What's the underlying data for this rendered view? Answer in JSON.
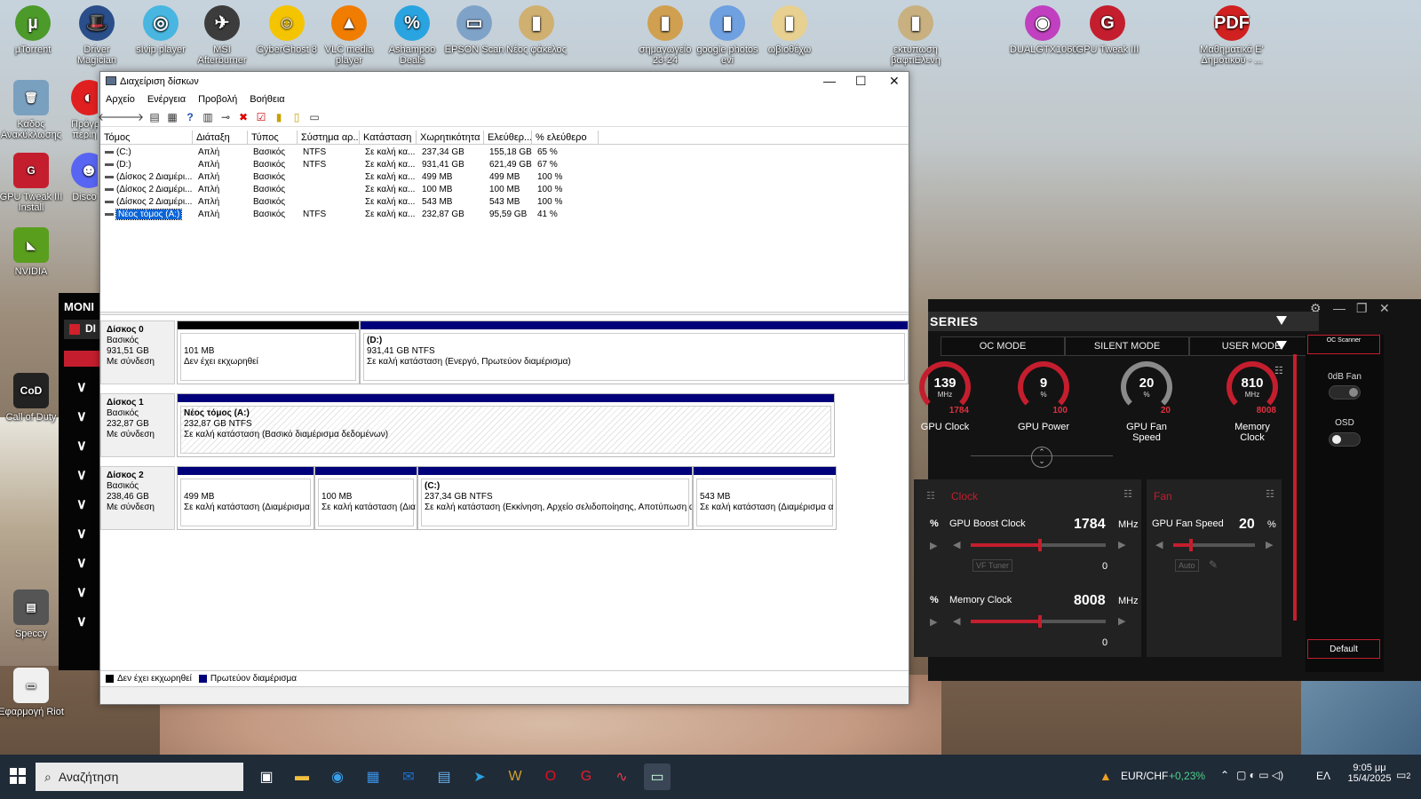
{
  "desktop": {
    "icons_top": [
      {
        "label": "µTorrent",
        "glyph": "µ",
        "color": "#4c9a2a"
      },
      {
        "label": "Driver Magician",
        "glyph": "🎩",
        "color": "#2a4e8a"
      },
      {
        "label": "sIvip player",
        "glyph": "◎",
        "color": "#48b6e0"
      },
      {
        "label": "MSI Afterburner",
        "glyph": "✈",
        "color": "#3c3c3c"
      },
      {
        "label": "CyberGhost 8",
        "glyph": "☺",
        "color": "#f5c400"
      },
      {
        "label": "VLC media player",
        "glyph": "▲",
        "color": "#f07c00"
      },
      {
        "label": "Ashampoo Deals",
        "glyph": "%",
        "color": "#2aa4e0"
      },
      {
        "label": "EPSON Scan",
        "glyph": "▭",
        "color": "#7fa2c8"
      },
      {
        "label": "Νέος φάκελος",
        "glyph": "▮",
        "color": "#d0b070"
      },
      {
        "label": "σημαγωγείο 23-24",
        "glyph": "▮",
        "color": "#d0a050"
      },
      {
        "label": "google photos evi",
        "glyph": "▮",
        "color": "#6fa0e0"
      },
      {
        "label": "ωβιοθέχω",
        "glyph": "▮",
        "color": "#e8d090"
      },
      {
        "label": "εκτυπωση βαφτιΕλενη",
        "glyph": "▮",
        "color": "#c8b080"
      },
      {
        "label": "DUALGTX1060",
        "glyph": "◉",
        "color": "#c040c0"
      },
      {
        "label": "GPU Tweak III",
        "glyph": "G",
        "color": "#c41e2e"
      },
      {
        "label": "Μαθηματικά Ε' Δημοτικού - ...",
        "glyph": "PDF",
        "color": "#d02020"
      }
    ],
    "icons_left": [
      {
        "label": "Κάδος Ανακύκλωσης",
        "glyph": "🗑",
        "color": "#7aa0c0"
      },
      {
        "label": "GPU Tweak III Install",
        "glyph": "G",
        "color": "#c41e2e"
      },
      {
        "label": "NVIDIA",
        "glyph": "◣",
        "color": "#5a9e1e"
      },
      {
        "label": "Call of Duty",
        "glyph": "CoD",
        "color": "#222222"
      },
      {
        "label": "Speccy",
        "glyph": "▤",
        "color": "#555555"
      },
      {
        "label": "Εφαρμογή Riot",
        "glyph": "▭",
        "color": "#f0f0f0"
      }
    ],
    "partial_icons": [
      {
        "label": "Πρόγρ περιη",
        "glyph": "◐",
        "color": "#e02020"
      },
      {
        "label": "Disco",
        "glyph": "☻",
        "color": "#5865f2"
      }
    ]
  },
  "window": {
    "title": "Διαχείριση δίσκων",
    "menu": [
      "Αρχείο",
      "Ενέργεια",
      "Προβολή",
      "Βοήθεια"
    ],
    "columns": [
      "Τόμος",
      "Διάταξη",
      "Τύπος",
      "Σύστημα αρ...",
      "Κατάσταση",
      "Χωρητικότητα",
      "Ελεύθερ...",
      "% ελεύθερο"
    ],
    "rows": [
      [
        "(C:)",
        "Απλή",
        "Βασικός",
        "NTFS",
        "Σε καλή κα...",
        "237,34 GB",
        "155,18 GB",
        "65 %"
      ],
      [
        "(D:)",
        "Απλή",
        "Βασικός",
        "NTFS",
        "Σε καλή κα...",
        "931,41 GB",
        "621,49 GB",
        "67 %"
      ],
      [
        "(Δίσκος 2 Διαμέρι...",
        "Απλή",
        "Βασικός",
        "",
        "Σε καλή κα...",
        "499 MB",
        "499 MB",
        "100 %"
      ],
      [
        "(Δίσκος 2 Διαμέρι...",
        "Απλή",
        "Βασικός",
        "",
        "Σε καλή κα...",
        "100 MB",
        "100 MB",
        "100 %"
      ],
      [
        "(Δίσκος 2 Διαμέρι...",
        "Απλή",
        "Βασικός",
        "",
        "Σε καλή κα...",
        "543 MB",
        "543 MB",
        "100 %"
      ],
      [
        "Νέος τόμος (A:)",
        "Απλή",
        "Βασικός",
        "NTFS",
        "Σε καλή κα...",
        "232,87 GB",
        "95,59 GB",
        "41 %"
      ]
    ],
    "disks": [
      {
        "name": "Δίσκος 0",
        "type": "Βασικός",
        "size": "931,51 GB",
        "status": "Με σύνδεση",
        "parts": [
          {
            "l1": "",
            "l2": "101 MB",
            "l3": "Δεν έχει εκχωρηθεί"
          },
          {
            "l1": "(D:)",
            "l2": "931,41 GB NTFS",
            "l3": "Σε καλή κατάσταση (Ενεργό, Πρωτεύον διαμέρισμα)"
          }
        ]
      },
      {
        "name": "Δίσκος 1",
        "type": "Βασικός",
        "size": "232,87 GB",
        "status": "Με σύνδεση",
        "parts": [
          {
            "l1": "Νέος τόμος  (A:)",
            "l2": "232,87 GB NTFS",
            "l3": "Σε καλή κατάσταση (Βασικό διαμέρισμα δεδομένων)"
          }
        ]
      },
      {
        "name": "Δίσκος 2",
        "type": "Βασικός",
        "size": "238,46 GB",
        "status": "Με σύνδεση",
        "parts": [
          {
            "l1": "",
            "l2": "499 MB",
            "l3": "Σε καλή κατάσταση (Διαμέρισμα"
          },
          {
            "l1": "",
            "l2": "100 MB",
            "l3": "Σε καλή κατάσταση (Δια"
          },
          {
            "l1": "(C:)",
            "l2": "237,34 GB NTFS",
            "l3": "Σε καλή κατάσταση (Εκκίνηση, Αρχείο σελιδοποίησης, Αποτύπωση α"
          },
          {
            "l1": "",
            "l2": "543 MB",
            "l3": "Σε καλή κατάσταση (Διαμέρισμα α"
          }
        ]
      }
    ],
    "legend": [
      "Δεν έχει εκχωρηθεί",
      "Πρωτεύον διαμέρισμα"
    ]
  },
  "monitor": {
    "title": "MONI",
    "sub": "DI",
    "chevrons": 9
  },
  "gpu_tweak": {
    "series": "SERIES",
    "modes": [
      "OC MODE",
      "SILENT MODE",
      "USER MODE"
    ],
    "gauges": [
      {
        "value": "139",
        "unit": "MHz",
        "max": "1784",
        "label": "GPU Clock",
        "grey": false
      },
      {
        "value": "9",
        "unit": "%",
        "max": "100",
        "label": "GPU Power",
        "grey": false
      },
      {
        "value": "20",
        "unit": "%",
        "max": "20",
        "label": "GPU Fan Speed",
        "grey": true
      },
      {
        "value": "810",
        "unit": "MHz",
        "max": "8008",
        "label": "Memory Clock",
        "grey": false
      }
    ],
    "clock_card": {
      "header": "Clock",
      "boost_label": "GPU Boost Clock",
      "boost_value": "1784",
      "boost_unit": "MHz",
      "vf_tuner": "VF Tuner",
      "boost_offset": "0",
      "mem_label": "Memory Clock",
      "mem_value": "8008",
      "mem_unit": "MHz",
      "mem_offset": "0"
    },
    "fan_card": {
      "header": "Fan",
      "label": "GPU Fan Speed",
      "value": "20",
      "unit": "%",
      "auto": "Auto"
    },
    "left_card": {
      "unit1": "%",
      "unit2": "%"
    },
    "side": {
      "scanner": "OC Scanner",
      "zero_db": "0dB Fan",
      "osd": "OSD",
      "default": "Default"
    }
  },
  "taskbar": {
    "search_placeholder": "Αναζήτηση",
    "ticker": "EUR/CHF",
    "ticker_change": "+0,23%",
    "lang": "ΕΛ",
    "time": "9:05 μμ",
    "date": "15/4/2025",
    "notifications": "2"
  }
}
